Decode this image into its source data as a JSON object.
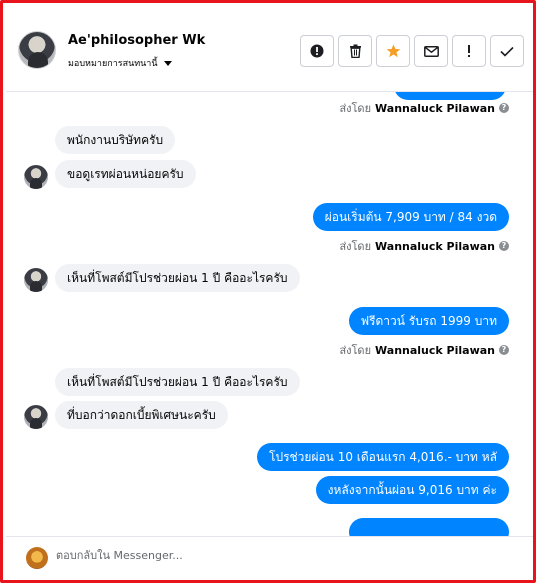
{
  "header": {
    "name": "Ae'philosopher Wk",
    "assign_label": "มอบหมายการสนทนานี้",
    "actions": [
      "report-icon",
      "trash-icon",
      "star-icon",
      "mail-icon",
      "exclamation-icon",
      "check-icon"
    ],
    "star_color": "#f59e27"
  },
  "messages": {
    "top_sentby": {
      "prefix": "ส่งโดย",
      "sender": "Wannaluck Pilawan"
    },
    "m1": "พนักงานบริษัทครับ",
    "m2": "ขอดูเรทผ่อนหน่อยครับ",
    "m3": "ผ่อนเริ่มต้น 7,909 บาท  / 84 งวด",
    "m3_sentby": {
      "prefix": "ส่งโดย",
      "sender": "Wannaluck Pilawan"
    },
    "m4": "เห็นที่โพสต์มีโปรช่วยผ่อน 1 ปี คืออะไรครับ",
    "m5": "ฟรีดาวน์  รับรถ 1999 บาท",
    "m5_sentby": {
      "prefix": "ส่งโดย",
      "sender": "Wannaluck Pilawan"
    },
    "m6": "เห็นที่โพสต์มีโปรช่วยผ่อน 1 ปี คืออะไรครับ",
    "m7": "ที่บอกว่าดอกเบี้ยพิเศษนะครับ",
    "m8": "โปรช่วยผ่อน 10 เดือนแรก  4,016.- บาท   หลั",
    "m9": "งหลังจากนั้นผ่อน 9,016 บาท ค่ะ",
    "accent": "#0084ff"
  },
  "footer": {
    "placeholder": "ตอบกลับใน Messenger..."
  }
}
